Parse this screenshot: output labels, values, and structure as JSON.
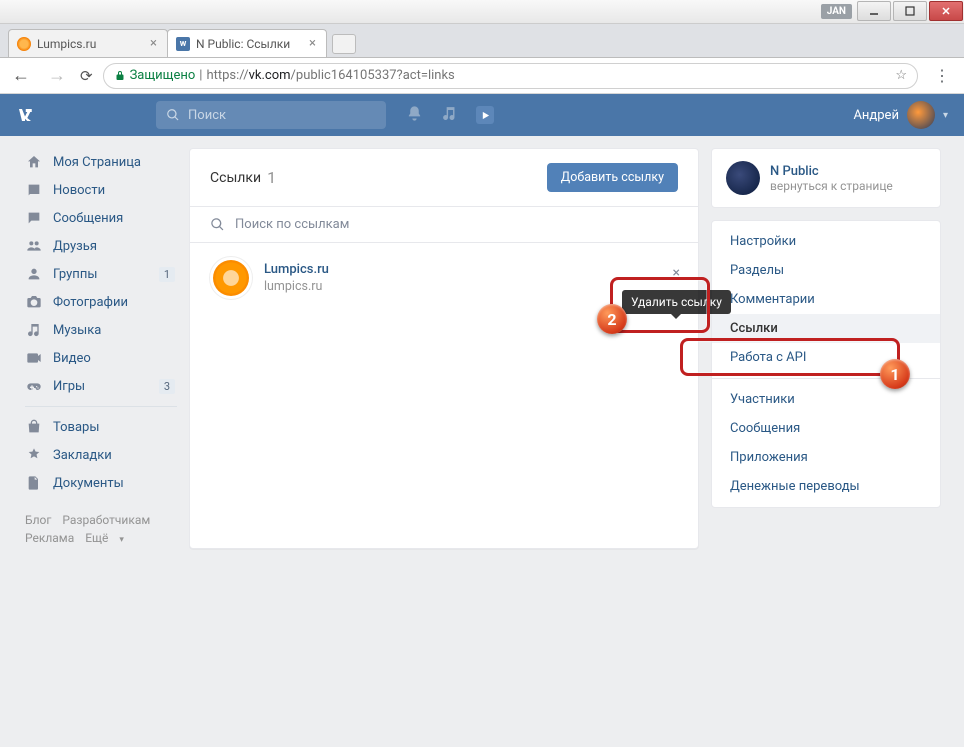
{
  "window": {
    "jan": "JAN"
  },
  "tabs": [
    {
      "title": "Lumpics.ru",
      "favicon": "orange"
    },
    {
      "title": "N Public: Ссылки",
      "favicon": "vk"
    }
  ],
  "addressbar": {
    "secure_label": "Защищено",
    "protocol": "https://",
    "host": "vk.com",
    "path": "/public164105337?act=links"
  },
  "vk_header": {
    "search_placeholder": "Поиск",
    "username": "Андрей"
  },
  "leftnav": {
    "items": [
      {
        "label": "Моя Страница",
        "icon": "home"
      },
      {
        "label": "Новости",
        "icon": "news"
      },
      {
        "label": "Сообщения",
        "icon": "msg"
      },
      {
        "label": "Друзья",
        "icon": "friends"
      },
      {
        "label": "Группы",
        "icon": "groups",
        "badge": "1"
      },
      {
        "label": "Фотографии",
        "icon": "photo"
      },
      {
        "label": "Музыка",
        "icon": "music"
      },
      {
        "label": "Видео",
        "icon": "video"
      },
      {
        "label": "Игры",
        "icon": "games",
        "badge": "3"
      }
    ],
    "items2": [
      {
        "label": "Товары",
        "icon": "market"
      },
      {
        "label": "Закладки",
        "icon": "bookmark"
      },
      {
        "label": "Документы",
        "icon": "docs"
      }
    ],
    "footer": {
      "blog": "Блог",
      "devs": "Разработчикам",
      "ads": "Реклама",
      "more": "Ещё"
    }
  },
  "main": {
    "title": "Ссылки",
    "count": "1",
    "add_button": "Добавить ссылку",
    "search_placeholder": "Поиск по ссылкам",
    "link": {
      "title": "Lumpics.ru",
      "url": "lumpics.ru"
    },
    "tooltip": "Удалить ссылку"
  },
  "right": {
    "group_name": "N Public",
    "back_label": "вернуться к странице",
    "menu": [
      "Настройки",
      "Разделы",
      "Комментарии",
      "Ссылки",
      "Работа с API",
      "Участники",
      "Сообщения",
      "Приложения",
      "Денежные переводы"
    ],
    "active_index": 3
  },
  "callouts": {
    "one": "1",
    "two": "2"
  }
}
